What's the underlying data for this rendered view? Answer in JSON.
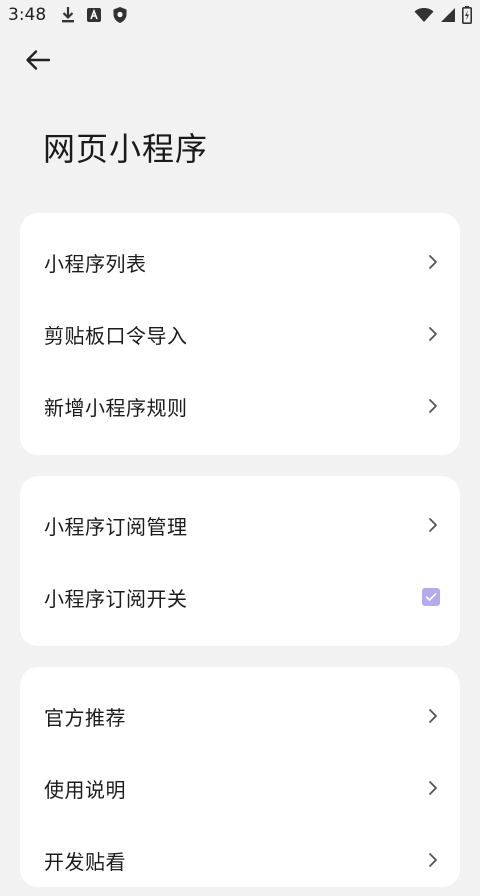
{
  "status_bar": {
    "time": "3:48",
    "icons": [
      "download-icon",
      "a-badge-icon",
      "shield-icon",
      "wifi-icon",
      "signal-icon",
      "battery-charging-icon"
    ]
  },
  "header": {
    "back_icon": "arrow-left-icon",
    "title": "网页小程序"
  },
  "groups": [
    {
      "items": [
        {
          "label": "小程序列表",
          "control": "chevron"
        },
        {
          "label": "剪贴板口令导入",
          "control": "chevron"
        },
        {
          "label": "新增小程序规则",
          "control": "chevron"
        }
      ]
    },
    {
      "items": [
        {
          "label": "小程序订阅管理",
          "control": "chevron"
        },
        {
          "label": "小程序订阅开关",
          "control": "checkbox",
          "checked": true
        }
      ]
    },
    {
      "items": [
        {
          "label": "官方推荐",
          "control": "chevron"
        },
        {
          "label": "使用说明",
          "control": "chevron"
        },
        {
          "label": "开发贴看",
          "control": "chevron"
        }
      ]
    }
  ],
  "colors": {
    "background": "#f2f2f2",
    "card": "#ffffff",
    "text": "#1c1c1c",
    "chevron": "#555555",
    "checkbox_fill": "#b5aaf0"
  }
}
